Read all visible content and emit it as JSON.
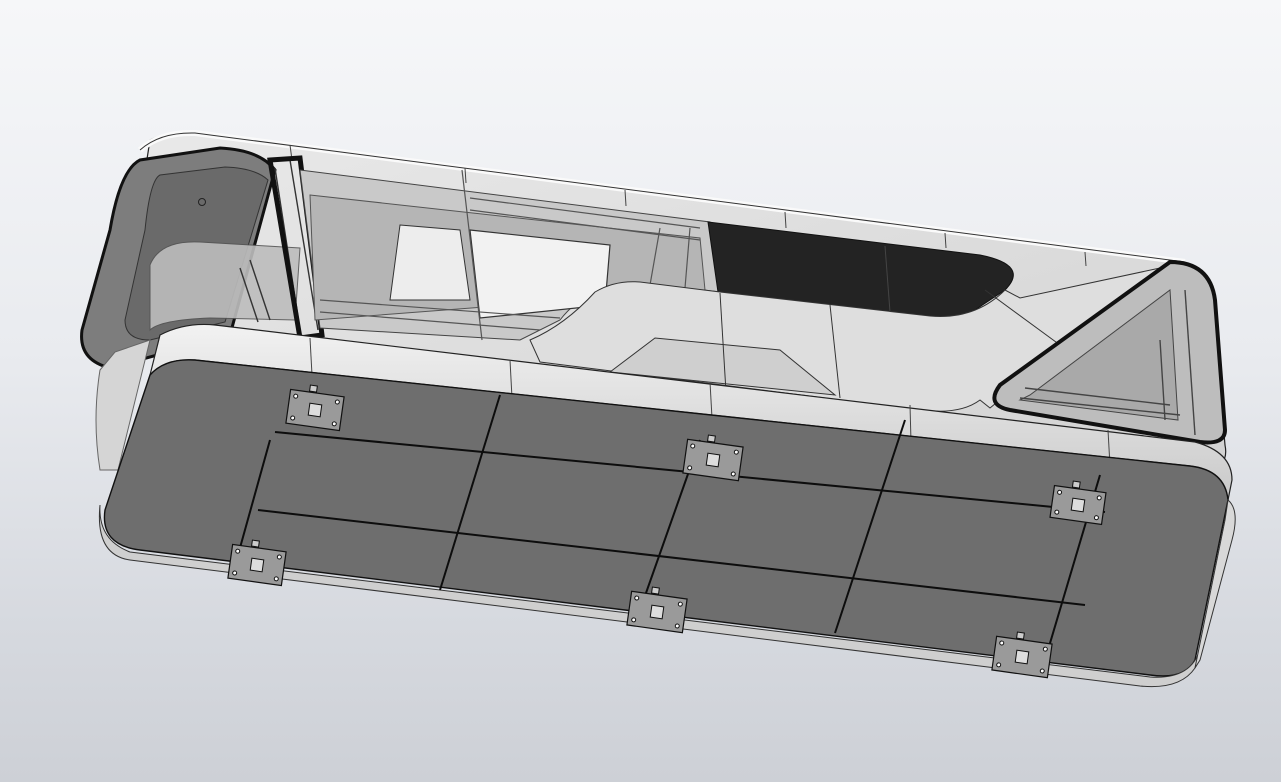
{
  "app": {
    "view": "3d-model-viewport",
    "background_top": "#f6f7f9",
    "background_bottom": "#cdd0d6"
  },
  "model": {
    "body_dark": "#6e6e6e",
    "body_light": "#e4e4e4",
    "glass": "#bfc0c2",
    "dark_panel": "#232323",
    "edge": "#111111",
    "mounting_plates": 6
  }
}
